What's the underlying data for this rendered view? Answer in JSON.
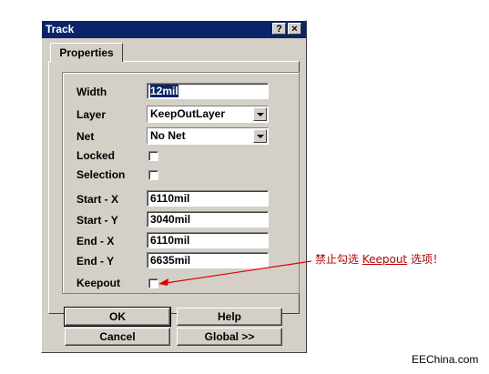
{
  "window": {
    "title": "Track",
    "help_glyph": "?",
    "close_glyph": "×"
  },
  "tab": {
    "label": "Properties"
  },
  "fields": {
    "width": {
      "label": "Width",
      "value": "12mil"
    },
    "layer": {
      "label": "Layer",
      "value": "KeepOutLayer"
    },
    "net": {
      "label": "Net",
      "value": "No Net"
    },
    "locked": {
      "label": "Locked",
      "checked": false
    },
    "selection": {
      "label": "Selection",
      "checked": false
    },
    "start_x": {
      "label": "Start - X",
      "value": "6110mil"
    },
    "start_y": {
      "label": "Start - Y",
      "value": "3040mil"
    },
    "end_x": {
      "label": "End - X",
      "value": "6110mil"
    },
    "end_y": {
      "label": "End - Y",
      "value": "6635mil"
    },
    "keepout": {
      "label": "Keepout",
      "checked": false
    }
  },
  "buttons": {
    "ok": "OK",
    "help": "Help",
    "cancel": "Cancel",
    "global": "Global >>"
  },
  "annotation": {
    "prefix": "禁止勾选 ",
    "keyword": "Keepout",
    "suffix": " 选项！",
    "color": "#c00000"
  },
  "watermark": "EEChina.com"
}
